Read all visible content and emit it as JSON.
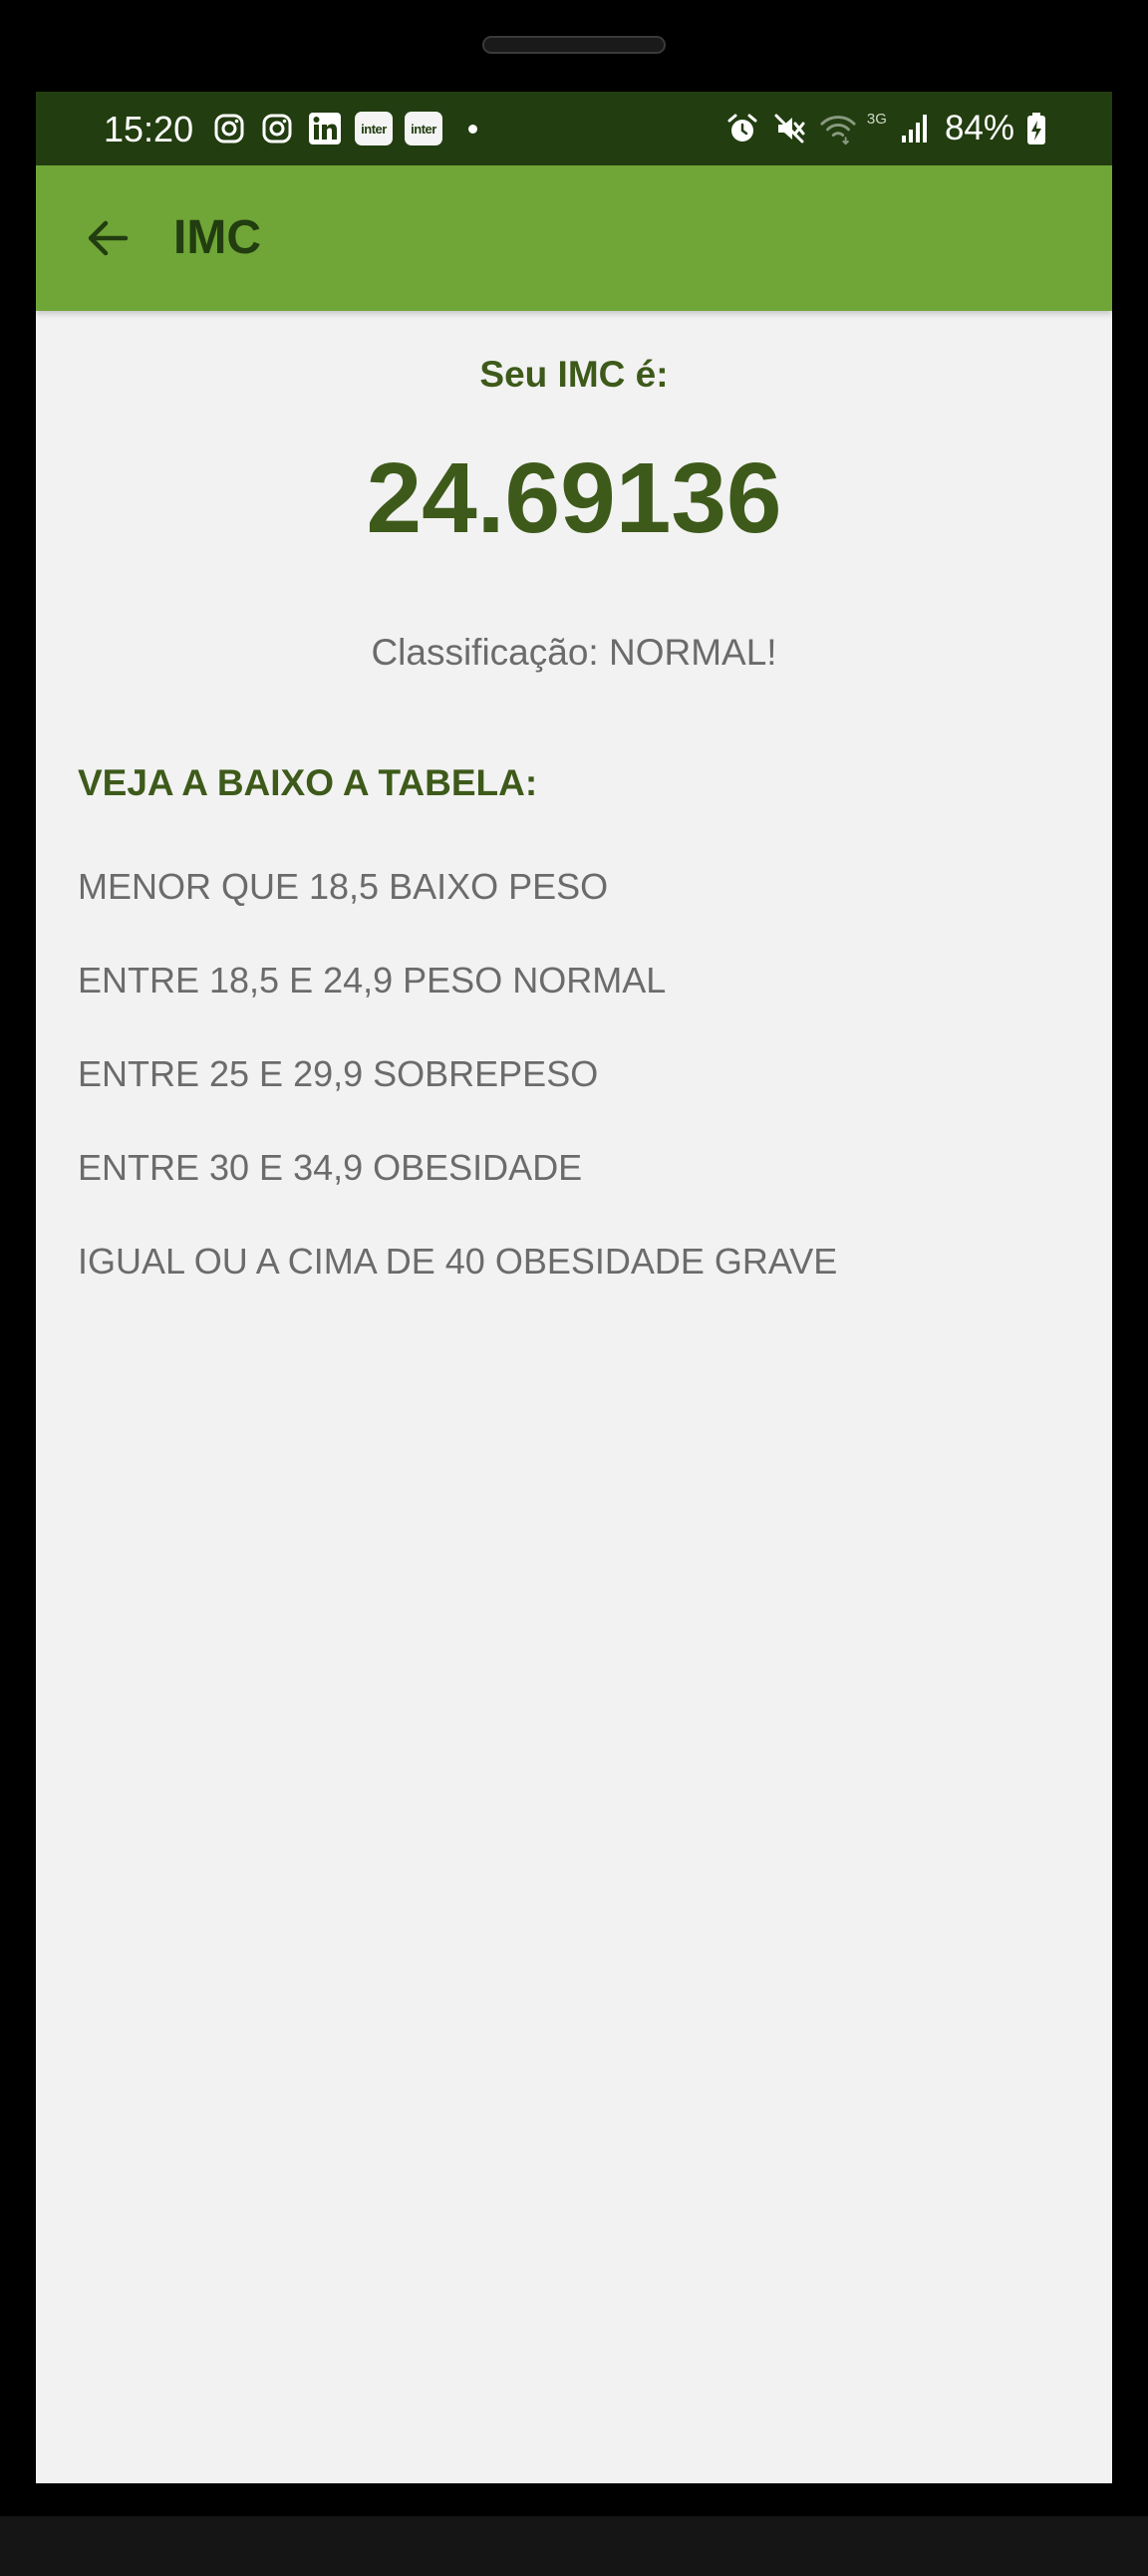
{
  "status_bar": {
    "time": "15:20",
    "left_icons": [
      "instagram-icon",
      "instagram-icon",
      "linkedin-icon",
      "inter-icon",
      "inter-icon",
      "notification-dot"
    ],
    "inter_label": "inter",
    "network_label": "3G",
    "battery": "84%",
    "right_icons": [
      "alarm-icon",
      "mute-icon",
      "wifi-icon",
      "signal-icon",
      "battery-charging-icon"
    ]
  },
  "app_bar": {
    "title": "IMC",
    "back_icon": "arrow-left-icon"
  },
  "result": {
    "label": "Seu IMC é:",
    "value": "24.69136",
    "classification": "Classificação: NORMAL!"
  },
  "table": {
    "heading": "VEJA A BAIXO A TABELA:",
    "rows": [
      "MENOR QUE 18,5 BAIXO PESO",
      "ENTRE 18,5 E 24,9 PESO NORMAL",
      "ENTRE 25 E 29,9 SOBREPESO",
      "ENTRE 30 E 34,9 OBESIDADE",
      "IGUAL OU A CIMA DE 40 OBESIDADE GRAVE"
    ]
  },
  "colors": {
    "status_bar": "#223d10",
    "app_bar": "#6fa637",
    "accent_text": "#3d5a1a",
    "body_text": "#6b6b6b",
    "background": "#f2f2f2"
  }
}
